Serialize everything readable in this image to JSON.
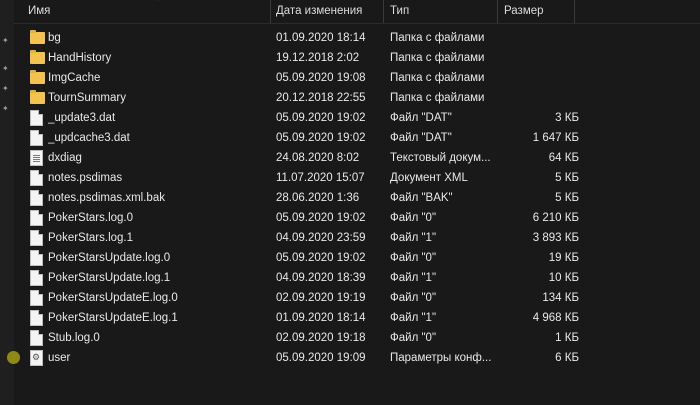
{
  "columns": {
    "name": "Имя",
    "date": "Дата изменения",
    "type": "Тип",
    "size": "Размер"
  },
  "files": [
    {
      "name": "bg",
      "date": "01.09.2020 18:14",
      "type": "Папка с файлами",
      "size": "",
      "icon": "folder-icon"
    },
    {
      "name": "HandHistory",
      "date": "19.12.2018 2:02",
      "type": "Папка с файлами",
      "size": "",
      "icon": "folder-icon"
    },
    {
      "name": "ImgCache",
      "date": "05.09.2020 19:08",
      "type": "Папка с файлами",
      "size": "",
      "icon": "folder-icon"
    },
    {
      "name": "TournSummary",
      "date": "20.12.2018 22:55",
      "type": "Папка с файлами",
      "size": "",
      "icon": "folder-icon"
    },
    {
      "name": "_update3.dat",
      "date": "05.09.2020 19:02",
      "type": "Файл \"DAT\"",
      "size": "3 КБ",
      "icon": "file-icon"
    },
    {
      "name": "_updcache3.dat",
      "date": "05.09.2020 19:02",
      "type": "Файл \"DAT\"",
      "size": "1 647 КБ",
      "icon": "file-icon"
    },
    {
      "name": "dxdiag",
      "date": "24.08.2020 8:02",
      "type": "Текстовый докум...",
      "size": "64 КБ",
      "icon": "text-file-icon"
    },
    {
      "name": "notes.psdimas",
      "date": "11.07.2020 15:07",
      "type": "Документ XML",
      "size": "5 КБ",
      "icon": "file-icon"
    },
    {
      "name": "notes.psdimas.xml.bak",
      "date": "28.06.2020 1:36",
      "type": "Файл \"BAK\"",
      "size": "5 КБ",
      "icon": "file-icon"
    },
    {
      "name": "PokerStars.log.0",
      "date": "05.09.2020 19:02",
      "type": "Файл \"0\"",
      "size": "6 210 КБ",
      "icon": "file-icon"
    },
    {
      "name": "PokerStars.log.1",
      "date": "04.09.2020 23:59",
      "type": "Файл \"1\"",
      "size": "3 893 КБ",
      "icon": "file-icon"
    },
    {
      "name": "PokerStarsUpdate.log.0",
      "date": "05.09.2020 19:02",
      "type": "Файл \"0\"",
      "size": "19 КБ",
      "icon": "file-icon"
    },
    {
      "name": "PokerStarsUpdate.log.1",
      "date": "04.09.2020 18:39",
      "type": "Файл \"1\"",
      "size": "10 КБ",
      "icon": "file-icon"
    },
    {
      "name": "PokerStarsUpdateE.log.0",
      "date": "02.09.2020 19:19",
      "type": "Файл \"0\"",
      "size": "134 КБ",
      "icon": "file-icon"
    },
    {
      "name": "PokerStarsUpdateE.log.1",
      "date": "01.09.2020 18:14",
      "type": "Файл \"1\"",
      "size": "4 968 КБ",
      "icon": "file-icon"
    },
    {
      "name": "Stub.log.0",
      "date": "02.09.2020 19:18",
      "type": "Файл \"0\"",
      "size": "1 КБ",
      "icon": "file-icon"
    },
    {
      "name": "user",
      "date": "05.09.2020 19:09",
      "type": "Параметры конф...",
      "size": "6 КБ",
      "icon": "config-file-icon"
    }
  ]
}
